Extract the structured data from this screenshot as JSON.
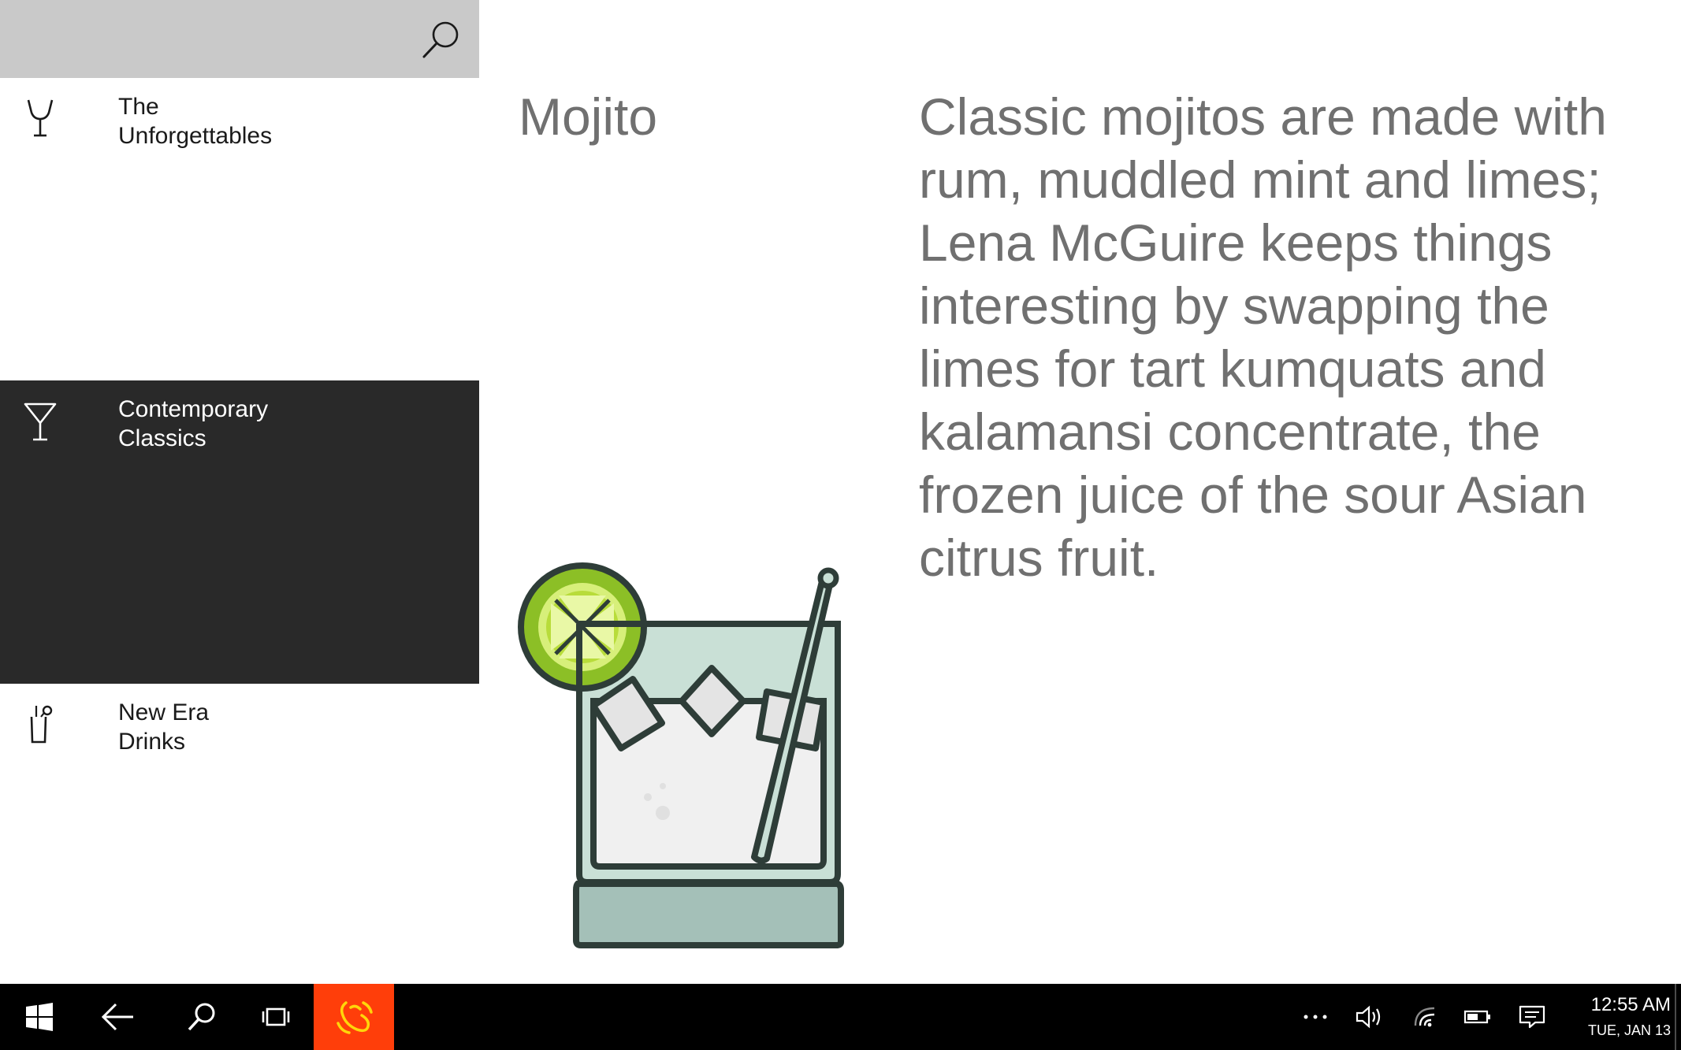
{
  "search": {
    "placeholder": "",
    "icon": "search-icon"
  },
  "nav": {
    "items": [
      {
        "label": "The\nUnforgettables",
        "icon": "wine-glass-icon",
        "selected": false
      },
      {
        "label": "Contemporary\nClassics",
        "icon": "martini-glass-icon",
        "selected": true
      },
      {
        "label": "New Era\nDrinks",
        "icon": "pint-glass-icon",
        "selected": false
      }
    ]
  },
  "detail": {
    "title": "Mojito",
    "description": "Classic mojitos are made with rum, muddled mint and limes; Lena McGuire keeps things interesting by swapping the limes for tart kumquats and kalamansi concentrate, the frozen juice of the sour Asian citrus fruit.",
    "illustration": "mojito-glass-illustration"
  },
  "taskbar": {
    "start_icon": "windows-logo-icon",
    "back_icon": "back-arrow-icon",
    "search_icon": "search-icon",
    "task_view_icon": "task-view-icon",
    "active_app_icon": "app-icon",
    "active_app_color": "#ff3e0a",
    "tray": {
      "overflow_icon": "more-icon",
      "volume_icon": "volume-icon",
      "network_icon": "wifi-icon",
      "battery_icon": "battery-icon",
      "notifications_icon": "action-center-icon"
    },
    "clock": {
      "time": "12:55 AM",
      "date": "TUE, JAN 13"
    }
  },
  "colors": {
    "search_bar": "#c9c9c9",
    "selected_item": "#292929",
    "body_text": "#707070",
    "taskbar": "#000000"
  }
}
